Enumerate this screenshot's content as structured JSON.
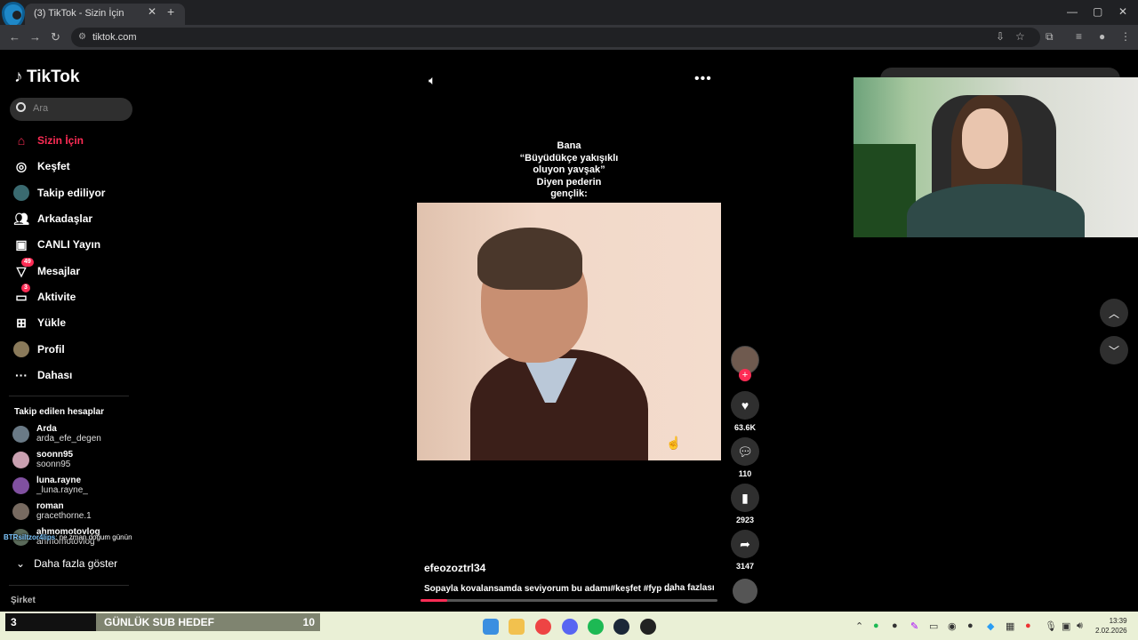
{
  "browser": {
    "tab_title": "(3) TikTok - Sizin İçin",
    "url": "tiktok.com"
  },
  "tiktok": {
    "logo_text": "TikTok",
    "search_placeholder": "Ara",
    "nav": [
      {
        "label": "Sizin İçin",
        "icon": "home-icon"
      },
      {
        "label": "Keşfet",
        "icon": "compass-icon"
      },
      {
        "label": "Takip ediliyor",
        "icon": "following-avatar-icon"
      },
      {
        "label": "Arkadaşlar",
        "icon": "friends-icon"
      },
      {
        "label": "CANLI Yayın",
        "icon": "live-tv-icon"
      },
      {
        "label": "Mesajlar",
        "icon": "messages-icon",
        "badge": "49"
      },
      {
        "label": "Aktivite",
        "icon": "activity-icon",
        "badge": "3"
      },
      {
        "label": "Yükle",
        "icon": "upload-icon"
      },
      {
        "label": "Profil",
        "icon": "profile-avatar-icon"
      },
      {
        "label": "Dahası",
        "icon": "more-dots-icon"
      }
    ],
    "followed_header": "Takip edilen hesaplar",
    "followed": [
      {
        "name": "Arda",
        "handle": "arda_efe_degen"
      },
      {
        "name": "soonn95",
        "handle": "soonn95"
      },
      {
        "name": "luna.rayne",
        "handle": "_luna.rayne_"
      },
      {
        "name": "roman",
        "handle": "gracethorne.1"
      },
      {
        "name": "ahmomotovlog",
        "handle": "ahmomotovlog"
      }
    ],
    "show_more": "Daha fazla göster",
    "company": "Şirket"
  },
  "overlay": {
    "chat_user": "BTRsiltzor4lips",
    "chat_msg": ": ne zman doğum günün"
  },
  "video": {
    "caption_lines": [
      "Bana",
      "“Büyüdükçe yakışıklı",
      "oluyon yavşak”",
      "Diyen pederin",
      "gençlik:"
    ],
    "author": "efeozoztrl34",
    "description": "Sopayla kovalansamda seviyorum bu adamı#keşfet #fyp ...",
    "more_label": "daha fazlası",
    "progress": 0.09,
    "likes": "63.6K",
    "comments": "110",
    "saves": "2923",
    "shares": "3147"
  },
  "stream_goal": {
    "current": "3",
    "label": "GÜNLÜK SUB HEDEF",
    "target": "10"
  },
  "clock": {
    "time": "13:39",
    "date": "2.02.2026"
  },
  "colors": {
    "accent": "#fe2c55",
    "background": "#000000",
    "taskbar": "#eaf0d6"
  }
}
